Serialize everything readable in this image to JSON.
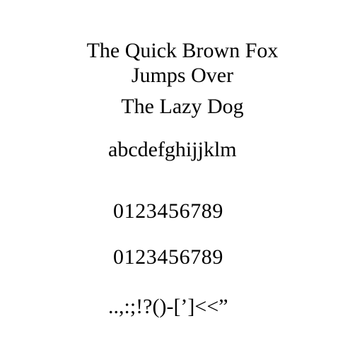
{
  "specimen": {
    "title_lines": [
      "The Quick Brown Fox",
      "Jumps Over",
      "The Lazy Dog"
    ],
    "lowercase": "abcdefghijjklm",
    "digits_1": "0123456789",
    "digits_2": "0123456789",
    "punctuation": "..,:;!?()-[’]<<”"
  }
}
